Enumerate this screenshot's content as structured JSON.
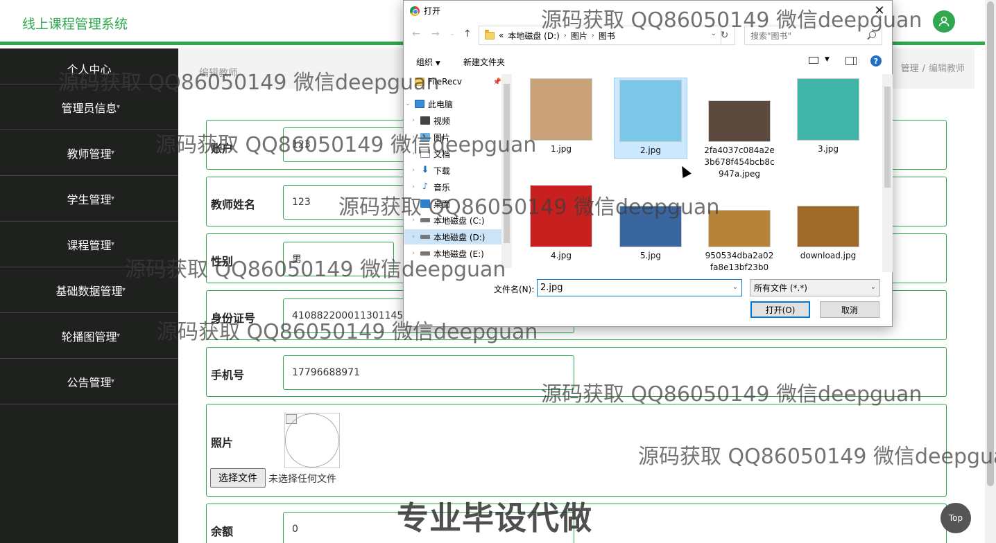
{
  "app": {
    "title": "线上课程管理系统"
  },
  "sidebar": {
    "items": [
      {
        "label": "个人中心"
      },
      {
        "label": "管理员信息"
      },
      {
        "label": "教师管理"
      },
      {
        "label": "学生管理"
      },
      {
        "label": "课程管理"
      },
      {
        "label": "基础数据管理"
      },
      {
        "label": "轮播图管理"
      },
      {
        "label": "公告管理"
      }
    ]
  },
  "breadcrumb": {
    "left": "编辑教师",
    "parent": "管理",
    "separator": "/",
    "current": "编辑教师"
  },
  "form": {
    "account": {
      "label": "账户",
      "value": "123"
    },
    "name": {
      "label": "教师姓名",
      "value": "123"
    },
    "gender": {
      "label": "性别",
      "value": "男"
    },
    "idcard": {
      "label": "身份证号",
      "value": "410882200011301145"
    },
    "phone": {
      "label": "手机号",
      "value": "17796688971"
    },
    "photo": {
      "label": "照片",
      "choose_button": "选择文件",
      "no_file": "未选择任何文件"
    },
    "balance": {
      "label": "余额",
      "value": "0"
    }
  },
  "top_button": {
    "label": "Top"
  },
  "dialog": {
    "title": "打开",
    "path": [
      "«",
      "本地磁盘 (D:)",
      "图片",
      "图书"
    ],
    "search_placeholder": "搜索\"图书\"",
    "organize": "组织",
    "new_folder": "新建文件夹",
    "tree": [
      {
        "label": "FileRecv",
        "icon": "folder-icon"
      },
      {
        "label": "此电脑",
        "icon": "computer-icon"
      },
      {
        "label": "视频",
        "icon": "video-icon"
      },
      {
        "label": "图片",
        "icon": "picture-icon"
      },
      {
        "label": "文档",
        "icon": "document-icon"
      },
      {
        "label": "下载",
        "icon": "download-icon"
      },
      {
        "label": "音乐",
        "icon": "music-icon"
      },
      {
        "label": "桌面",
        "icon": "desktop-icon"
      },
      {
        "label": "本地磁盘 (C:)",
        "icon": "drive-icon"
      },
      {
        "label": "本地磁盘 (D:)",
        "icon": "drive-icon"
      },
      {
        "label": "本地磁盘 (E:)",
        "icon": "drive-icon"
      }
    ],
    "files": [
      {
        "name": "1.jpg",
        "color": "#c9a27a"
      },
      {
        "name": "2.jpg",
        "color": "#7cc7e8"
      },
      {
        "name": "2fa4037c084a2e3b678f454bcb8c947a.jpeg",
        "color": "#5b4a3d"
      },
      {
        "name": "3.jpg",
        "color": "#3fb6a8"
      },
      {
        "name": "4.jpg",
        "color": "#c8201f"
      },
      {
        "name": "5.jpg",
        "color": "#3a66a0"
      },
      {
        "name": "950534dba2a02fa8e13bf23b0",
        "color": "#b5833a"
      },
      {
        "name": "download.jpg",
        "color": "#a06a2a"
      }
    ],
    "filename_label": "文件名(N):",
    "filename": "2.jpg",
    "filetype": "所有文件 (*.*)",
    "open_button": "打开(O)",
    "cancel_button": "取消"
  },
  "watermarks": {
    "text": "源码获取 QQ86050149 微信deepguan",
    "partial": "源码获取 QQ86050149 微信deepgua",
    "banner": "专业毕设代做"
  },
  "colors": {
    "brand_green": "#2fa84f",
    "sidebar_bg": "#1f211f",
    "dialog_accent": "#0078d7"
  }
}
